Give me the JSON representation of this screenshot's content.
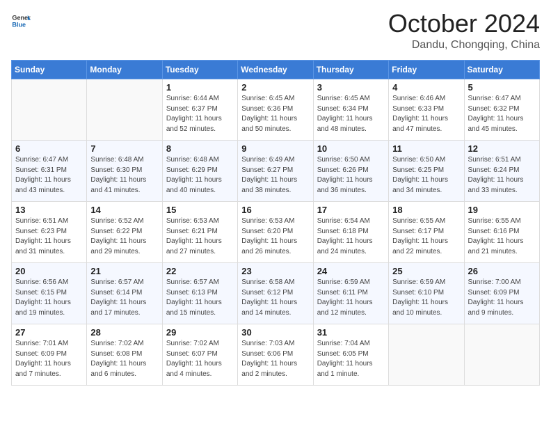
{
  "header": {
    "logo_general": "General",
    "logo_blue": "Blue",
    "month_title": "October 2024",
    "subtitle": "Dandu, Chongqing, China"
  },
  "weekdays": [
    "Sunday",
    "Monday",
    "Tuesday",
    "Wednesday",
    "Thursday",
    "Friday",
    "Saturday"
  ],
  "weeks": [
    [
      {
        "day": "",
        "sunrise": "",
        "sunset": "",
        "daylight": ""
      },
      {
        "day": "",
        "sunrise": "",
        "sunset": "",
        "daylight": ""
      },
      {
        "day": "1",
        "sunrise": "Sunrise: 6:44 AM",
        "sunset": "Sunset: 6:37 PM",
        "daylight": "Daylight: 11 hours and 52 minutes."
      },
      {
        "day": "2",
        "sunrise": "Sunrise: 6:45 AM",
        "sunset": "Sunset: 6:36 PM",
        "daylight": "Daylight: 11 hours and 50 minutes."
      },
      {
        "day": "3",
        "sunrise": "Sunrise: 6:45 AM",
        "sunset": "Sunset: 6:34 PM",
        "daylight": "Daylight: 11 hours and 48 minutes."
      },
      {
        "day": "4",
        "sunrise": "Sunrise: 6:46 AM",
        "sunset": "Sunset: 6:33 PM",
        "daylight": "Daylight: 11 hours and 47 minutes."
      },
      {
        "day": "5",
        "sunrise": "Sunrise: 6:47 AM",
        "sunset": "Sunset: 6:32 PM",
        "daylight": "Daylight: 11 hours and 45 minutes."
      }
    ],
    [
      {
        "day": "6",
        "sunrise": "Sunrise: 6:47 AM",
        "sunset": "Sunset: 6:31 PM",
        "daylight": "Daylight: 11 hours and 43 minutes."
      },
      {
        "day": "7",
        "sunrise": "Sunrise: 6:48 AM",
        "sunset": "Sunset: 6:30 PM",
        "daylight": "Daylight: 11 hours and 41 minutes."
      },
      {
        "day": "8",
        "sunrise": "Sunrise: 6:48 AM",
        "sunset": "Sunset: 6:29 PM",
        "daylight": "Daylight: 11 hours and 40 minutes."
      },
      {
        "day": "9",
        "sunrise": "Sunrise: 6:49 AM",
        "sunset": "Sunset: 6:27 PM",
        "daylight": "Daylight: 11 hours and 38 minutes."
      },
      {
        "day": "10",
        "sunrise": "Sunrise: 6:50 AM",
        "sunset": "Sunset: 6:26 PM",
        "daylight": "Daylight: 11 hours and 36 minutes."
      },
      {
        "day": "11",
        "sunrise": "Sunrise: 6:50 AM",
        "sunset": "Sunset: 6:25 PM",
        "daylight": "Daylight: 11 hours and 34 minutes."
      },
      {
        "day": "12",
        "sunrise": "Sunrise: 6:51 AM",
        "sunset": "Sunset: 6:24 PM",
        "daylight": "Daylight: 11 hours and 33 minutes."
      }
    ],
    [
      {
        "day": "13",
        "sunrise": "Sunrise: 6:51 AM",
        "sunset": "Sunset: 6:23 PM",
        "daylight": "Daylight: 11 hours and 31 minutes."
      },
      {
        "day": "14",
        "sunrise": "Sunrise: 6:52 AM",
        "sunset": "Sunset: 6:22 PM",
        "daylight": "Daylight: 11 hours and 29 minutes."
      },
      {
        "day": "15",
        "sunrise": "Sunrise: 6:53 AM",
        "sunset": "Sunset: 6:21 PM",
        "daylight": "Daylight: 11 hours and 27 minutes."
      },
      {
        "day": "16",
        "sunrise": "Sunrise: 6:53 AM",
        "sunset": "Sunset: 6:20 PM",
        "daylight": "Daylight: 11 hours and 26 minutes."
      },
      {
        "day": "17",
        "sunrise": "Sunrise: 6:54 AM",
        "sunset": "Sunset: 6:18 PM",
        "daylight": "Daylight: 11 hours and 24 minutes."
      },
      {
        "day": "18",
        "sunrise": "Sunrise: 6:55 AM",
        "sunset": "Sunset: 6:17 PM",
        "daylight": "Daylight: 11 hours and 22 minutes."
      },
      {
        "day": "19",
        "sunrise": "Sunrise: 6:55 AM",
        "sunset": "Sunset: 6:16 PM",
        "daylight": "Daylight: 11 hours and 21 minutes."
      }
    ],
    [
      {
        "day": "20",
        "sunrise": "Sunrise: 6:56 AM",
        "sunset": "Sunset: 6:15 PM",
        "daylight": "Daylight: 11 hours and 19 minutes."
      },
      {
        "day": "21",
        "sunrise": "Sunrise: 6:57 AM",
        "sunset": "Sunset: 6:14 PM",
        "daylight": "Daylight: 11 hours and 17 minutes."
      },
      {
        "day": "22",
        "sunrise": "Sunrise: 6:57 AM",
        "sunset": "Sunset: 6:13 PM",
        "daylight": "Daylight: 11 hours and 15 minutes."
      },
      {
        "day": "23",
        "sunrise": "Sunrise: 6:58 AM",
        "sunset": "Sunset: 6:12 PM",
        "daylight": "Daylight: 11 hours and 14 minutes."
      },
      {
        "day": "24",
        "sunrise": "Sunrise: 6:59 AM",
        "sunset": "Sunset: 6:11 PM",
        "daylight": "Daylight: 11 hours and 12 minutes."
      },
      {
        "day": "25",
        "sunrise": "Sunrise: 6:59 AM",
        "sunset": "Sunset: 6:10 PM",
        "daylight": "Daylight: 11 hours and 10 minutes."
      },
      {
        "day": "26",
        "sunrise": "Sunrise: 7:00 AM",
        "sunset": "Sunset: 6:09 PM",
        "daylight": "Daylight: 11 hours and 9 minutes."
      }
    ],
    [
      {
        "day": "27",
        "sunrise": "Sunrise: 7:01 AM",
        "sunset": "Sunset: 6:09 PM",
        "daylight": "Daylight: 11 hours and 7 minutes."
      },
      {
        "day": "28",
        "sunrise": "Sunrise: 7:02 AM",
        "sunset": "Sunset: 6:08 PM",
        "daylight": "Daylight: 11 hours and 6 minutes."
      },
      {
        "day": "29",
        "sunrise": "Sunrise: 7:02 AM",
        "sunset": "Sunset: 6:07 PM",
        "daylight": "Daylight: 11 hours and 4 minutes."
      },
      {
        "day": "30",
        "sunrise": "Sunrise: 7:03 AM",
        "sunset": "Sunset: 6:06 PM",
        "daylight": "Daylight: 11 hours and 2 minutes."
      },
      {
        "day": "31",
        "sunrise": "Sunrise: 7:04 AM",
        "sunset": "Sunset: 6:05 PM",
        "daylight": "Daylight: 11 hours and 1 minute."
      },
      {
        "day": "",
        "sunrise": "",
        "sunset": "",
        "daylight": ""
      },
      {
        "day": "",
        "sunrise": "",
        "sunset": "",
        "daylight": ""
      }
    ]
  ]
}
